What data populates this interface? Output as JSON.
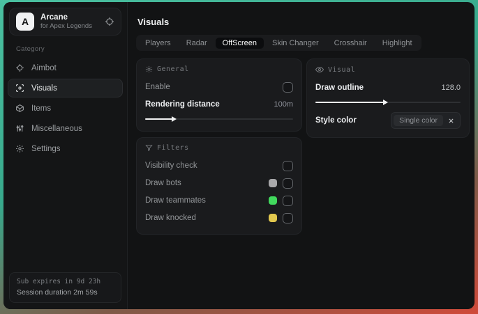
{
  "app": {
    "name": "Arcane",
    "subtitle": "for Apex Legends",
    "logo_letter": "A"
  },
  "sidebar": {
    "category_label": "Category",
    "items": [
      {
        "label": "Aimbot",
        "icon": "crosshair-icon",
        "active": false
      },
      {
        "label": "Visuals",
        "icon": "scan-icon",
        "active": true
      },
      {
        "label": "Items",
        "icon": "box-icon",
        "active": false
      },
      {
        "label": "Miscellaneous",
        "icon": "sliders-icon",
        "active": false
      },
      {
        "label": "Settings",
        "icon": "gear-icon",
        "active": false
      }
    ],
    "footer": {
      "sub_expires": "Sub expires in 9d 23h",
      "session_duration": "Session duration 2m 59s"
    }
  },
  "header": {
    "title": "Visuals"
  },
  "tabs": {
    "items": [
      "Players",
      "Radar",
      "OffScreen",
      "Skin Changer",
      "Crosshair",
      "Highlight"
    ],
    "active": "OffScreen"
  },
  "panels": {
    "general": {
      "title": "General",
      "enable_label": "Enable",
      "enable_checked": false,
      "rendering_distance_label": "Rendering distance",
      "rendering_distance_value": "100m",
      "slider_percent": 21
    },
    "filters": {
      "title": "Filters",
      "rows": [
        {
          "label": "Visibility check",
          "swatch": null,
          "checked": false
        },
        {
          "label": "Draw bots",
          "swatch": "#a8a8aa",
          "checked": false
        },
        {
          "label": "Draw teammates",
          "swatch": "#41d95d",
          "checked": false
        },
        {
          "label": "Draw knocked",
          "swatch": "#e2c84e",
          "checked": false
        }
      ]
    },
    "visual": {
      "title": "Visual",
      "draw_outline_label": "Draw outline",
      "draw_outline_value": "128.0",
      "slider_percent": 50,
      "style_color_label": "Style color",
      "style_color_value": "Single color"
    }
  },
  "colors": {
    "frame_teal": "#3fb79a",
    "frame_red": "#d04a3a",
    "swatch_gray": "#a8a8aa",
    "swatch_green": "#41d95d",
    "swatch_yellow": "#e2c84e"
  }
}
